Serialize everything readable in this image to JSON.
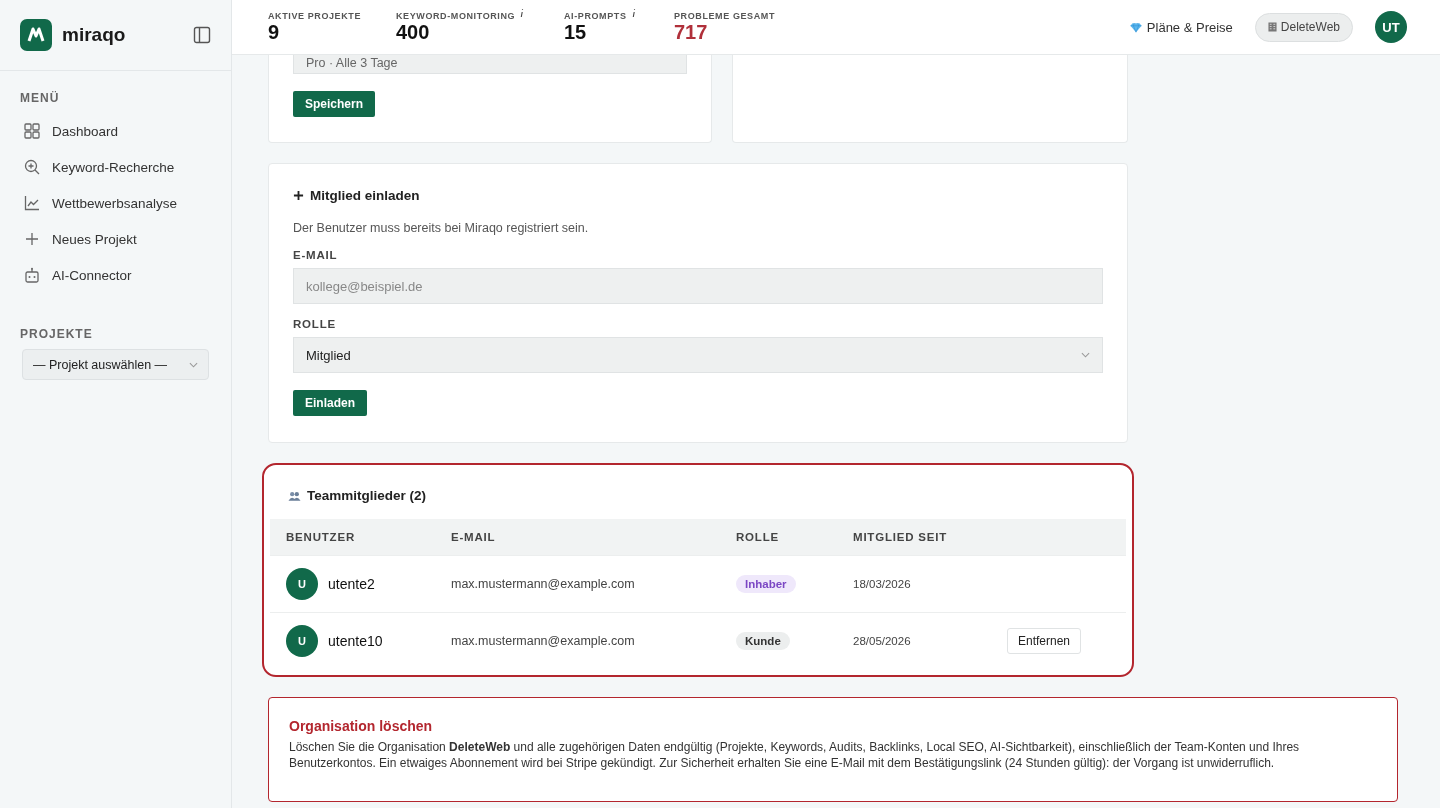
{
  "sidebar": {
    "logo": "miraqo",
    "menu_heading": "MENÜ",
    "menu": [
      {
        "label": "Dashboard"
      },
      {
        "label": "Keyword-Recherche"
      },
      {
        "label": "Wettbewerbsanalyse"
      },
      {
        "label": "Neues Projekt"
      },
      {
        "label": "AI-Connector"
      }
    ],
    "projects_heading": "PROJEKTE",
    "project_select": "— Projekt auswählen —"
  },
  "header": {
    "stats": [
      {
        "label": "AKTIVE PROJEKTE",
        "value": "9",
        "info": false,
        "alert": false
      },
      {
        "label": "KEYWORD-MONITORING",
        "value": "400",
        "info": true,
        "alert": false
      },
      {
        "label": "AI-PROMPTS",
        "value": "15",
        "info": true,
        "alert": false
      },
      {
        "label": "PROBLEME GESAMT",
        "value": "717",
        "info": false,
        "alert": true
      }
    ],
    "plans_link": "Pläne & Preise",
    "org_button": "DeleteWeb",
    "avatar": "UT"
  },
  "plan_card": {
    "field_value": "Pro · Alle 3 Tage",
    "button": "Speichern"
  },
  "invite": {
    "title": "Mitglied einladen",
    "hint": "Der Benutzer muss bereits bei Miraqo registriert sein.",
    "email_label": "E-MAIL",
    "email_placeholder": "kollege@beispiel.de",
    "role_label": "ROLLE",
    "role_value": "Mitglied",
    "button": "Einladen"
  },
  "team": {
    "title": "Teammitglieder (2)",
    "columns": [
      "BENUTZER",
      "E-MAIL",
      "ROLLE",
      "MITGLIED SEIT"
    ],
    "rows": [
      {
        "initial": "U",
        "name": "utente2",
        "email": "max.mustermann@example.com",
        "role": "Inhaber",
        "color": "#efe8fb",
        "since": "18/03/2026"
      },
      {
        "initial": "U",
        "name": "utente10",
        "email": "max.mustermann@example.com",
        "role": "Kunde",
        "color": "#eceeee",
        "since": "28/05/2026",
        "action": "Entfernen"
      }
    ]
  },
  "danger": {
    "title": "Organisation löschen",
    "text": "Löschen Sie die Organisation **DeleteWeb** und alle zugehörigen Daten endgültig (Projekte, Keywords, Audits, Backlinks, Local SEO, AI-Sichtbarkeit), einschließlich der Team-Konten und Ihres Benutzerkontos. Ein etwaiges Abonnement wird bei Stripe gekündigt. Zur Sicherheit erhalten Sie eine E-Mail mit dem Bestätigungslink (24 Stunden gültig): der Vorgang ist unwiderruflich."
  }
}
